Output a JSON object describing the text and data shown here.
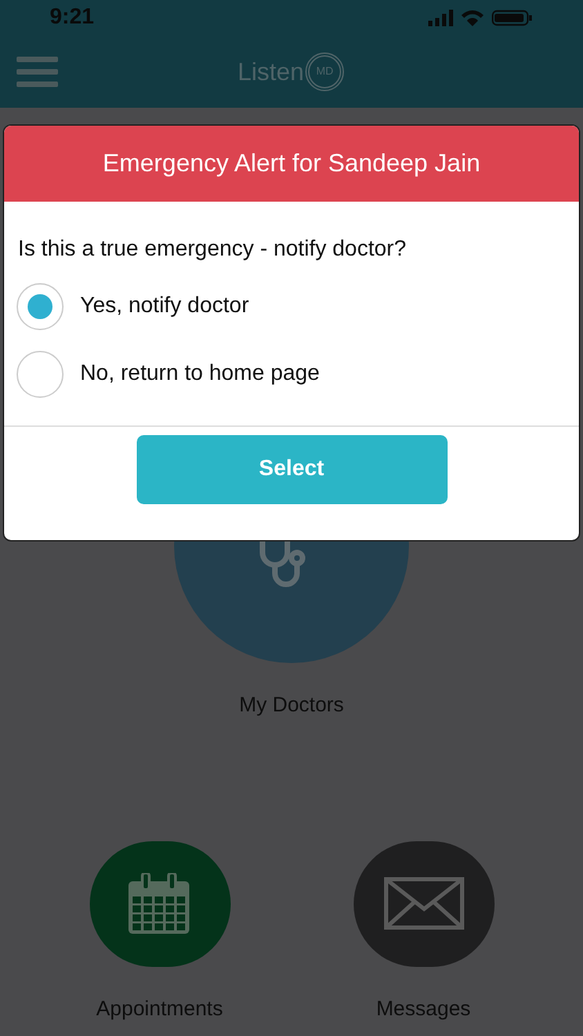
{
  "status_bar": {
    "time": "9:21"
  },
  "nav_bar": {
    "logo_text": "Listen",
    "logo_badge": "MD"
  },
  "home_tiles": [
    {
      "kind": "large",
      "label": "My Doctors",
      "color": "#23404f"
    },
    {
      "kind": "calendar",
      "label": "Appointments",
      "color": "#04331a"
    },
    {
      "kind": "mail",
      "label": "Messages",
      "color": "#1f1f20"
    }
  ],
  "dialog": {
    "title": "Emergency Alert for Sandeep Jain",
    "question": "Is this a true emergency - notify doctor?",
    "options": [
      {
        "label": "Yes, notify doctor",
        "selected": true
      },
      {
        "label": "No, return to home page",
        "selected": false
      }
    ],
    "button": "Select"
  }
}
